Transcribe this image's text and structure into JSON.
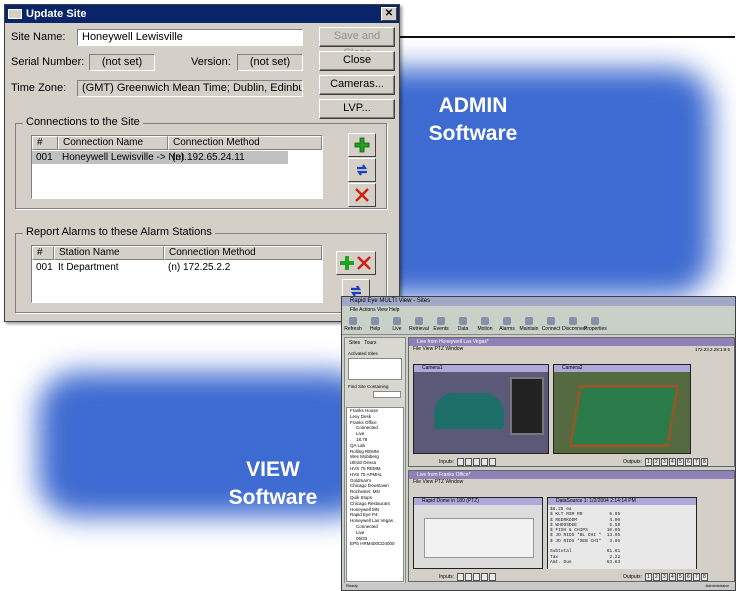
{
  "promo": {
    "admin_line1": "ADMIN",
    "admin_line2": "Software",
    "view_line1": "VIEW",
    "view_line2": "Software"
  },
  "admin": {
    "title": "Update Site",
    "site_name_label": "Site Name:",
    "site_name_value": "Honeywell Lewisville",
    "serial_label": "Serial Number:",
    "serial_value": "(not set)",
    "version_label": "Version:",
    "version_value": "(not set)",
    "timezone_label": "Time Zone:",
    "timezone_value": "(GMT) Greenwich Mean Time; Dublin, Edinburgh, London, Lisbo",
    "save_close": "Save and Close",
    "close": "Close",
    "cameras": "Cameras...",
    "lvp": "LVP...",
    "connections_group": "Connections to the Site",
    "connections_headers": [
      "#",
      "Connection Name",
      "Connection Method"
    ],
    "connections_rows": [
      {
        "num": "001",
        "name": "Honeywell Lewisville -> Net...",
        "method": "(n) 192.65.24.11"
      }
    ],
    "alarms_group": "Report Alarms to these Alarm Stations",
    "alarms_headers": [
      "#",
      "Station Name",
      "Connection Method"
    ],
    "alarms_rows": [
      {
        "num": "001",
        "name": "It Department",
        "method": "(n) 172.25.2.2"
      }
    ]
  },
  "view": {
    "title": "Rapid Eye MULTI View - Sites",
    "menu": "File  Actions  View  Help",
    "toolbar": [
      "Refresh",
      "Help",
      "Live",
      "Retrieval",
      "Events",
      "Data",
      "Motion",
      "Alarms",
      "Maintain",
      "Connect",
      "Disconnect",
      "Properties"
    ],
    "tab_sites": "Sites",
    "tab_tours": "Tours",
    "activated_sites": "Activated Sites",
    "find_site": "Find Site Containing",
    "tree": [
      "Franks House",
      "Lexy Desk",
      "Franks Office",
      "Connected",
      "Live",
      "18.78",
      "QA Lab",
      "Rolling REMM",
      "Wes Mobiberg",
      "Ultratl Oessa",
      "HVS 75 REMM",
      "HVS 75 APMHL",
      "Goldman's",
      "Chicago Downtown",
      "Rochester, MN",
      "Quik Stops",
      "Chicago Restaurant",
      "Honeywell MN",
      "Rapid Eye P4",
      "Honeywell Las Vegas",
      "Connected",
      "Live",
      "06/33",
      "EPS HRM400CD4000"
    ],
    "pane1_title": "Live from Honeywell Las Vegas*",
    "pane1_menu": "File  View  PTZ  Window",
    "pane1_addr": "172.23.2.28:1:8.5",
    "cam1_title": "Camera1",
    "cam2_title": "Camera2",
    "inputs_label": "Inputs:",
    "outputs_label": "Outputs:",
    "outputs": [
      "1",
      "2",
      "3",
      "4",
      "5",
      "6",
      "7",
      "8"
    ],
    "pane2_title": "Live from Franks Office*",
    "pane2_menu": "File  View  PTZ  Window",
    "cam3_title": "Rapid Dome in 180 (PTZ)",
    "cam4_title": "DataSource 1: 1/2/2004 2:14:14 PM",
    "receipt": "$8.25 ea\n$ KLT RSM RR          6.95\n$ REDRKDDM            4.00\n$ WHOOSDGE            5.50\n$ FISH & CHIPS       10.95\n$ JD RIDS *BL CHI *  13.95\n$ JD RIDS *SEB CHI*   3.95\n\nSubtotal             61.61\nTax                   2.22\nAmt. Due             63.63",
    "status": "Ready",
    "status_right": "Administrator"
  }
}
